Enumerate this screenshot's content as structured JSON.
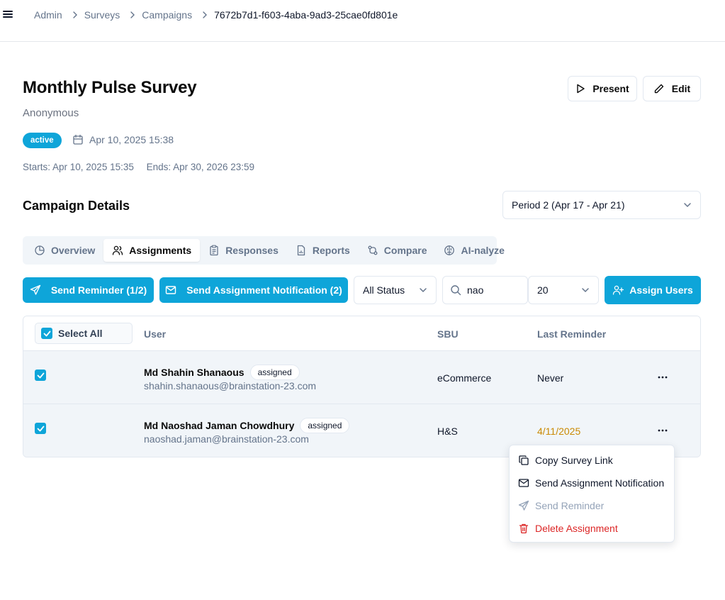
{
  "breadcrumb": {
    "items": [
      "Admin",
      "Surveys",
      "Campaigns"
    ],
    "current": "7672b7d1-f603-4aba-9ad3-25cae0fd801e"
  },
  "survey": {
    "title": "Monthly Pulse Survey",
    "subtitle": "Anonymous",
    "status": "active",
    "created": "Apr 10, 2025 15:38",
    "starts": "Starts: Apr 10, 2025 15:35",
    "ends": "Ends: Apr 30, 2026 23:59"
  },
  "actions": {
    "present_label": "Present",
    "edit_label": "Edit"
  },
  "campaign": {
    "section_title": "Campaign Details",
    "period": "Period 2 (Apr 17 - Apr 21)"
  },
  "tabs": [
    {
      "label": "Overview",
      "icon": "pie-chart-icon"
    },
    {
      "label": "Assignments",
      "icon": "users-icon",
      "active": true
    },
    {
      "label": "Responses",
      "icon": "clipboard-icon"
    },
    {
      "label": "Reports",
      "icon": "file-chart-icon"
    },
    {
      "label": "Compare",
      "icon": "git-compare-icon"
    },
    {
      "label": "AI-nalyze",
      "icon": "brain-icon"
    }
  ],
  "toolbar": {
    "send_reminder": "Send Reminder (1/2)",
    "send_notification": "Send Assignment Notification (2)",
    "status_filter": "All Status",
    "search_value": "nao",
    "page_size": "20",
    "assign_users": "Assign Users"
  },
  "table": {
    "select_all": "Select All",
    "columns": {
      "user": "User",
      "sbu": "SBU",
      "last_reminder": "Last Reminder"
    },
    "rows": [
      {
        "name": "Md Shahin Shanaous",
        "status": "assigned",
        "email": "shahin.shanaous@brainstation-23.com",
        "sbu": "eCommerce",
        "last_reminder": "Never",
        "checked": true
      },
      {
        "name": "Md Naoshad Jaman Chowdhury",
        "status": "assigned",
        "email": "naoshad.jaman@brainstation-23.com",
        "sbu": "H&S",
        "last_reminder": "4/11/2025",
        "checked": true
      }
    ]
  },
  "row_menu": {
    "copy_link": "Copy Survey Link",
    "send_notification": "Send Assignment Notification",
    "send_reminder": "Send Reminder",
    "delete": "Delete Assignment"
  },
  "colors": {
    "accent": "#0ea5d9",
    "danger": "#dc2626",
    "warning": "#ca8a04",
    "muted": "#64748b"
  }
}
